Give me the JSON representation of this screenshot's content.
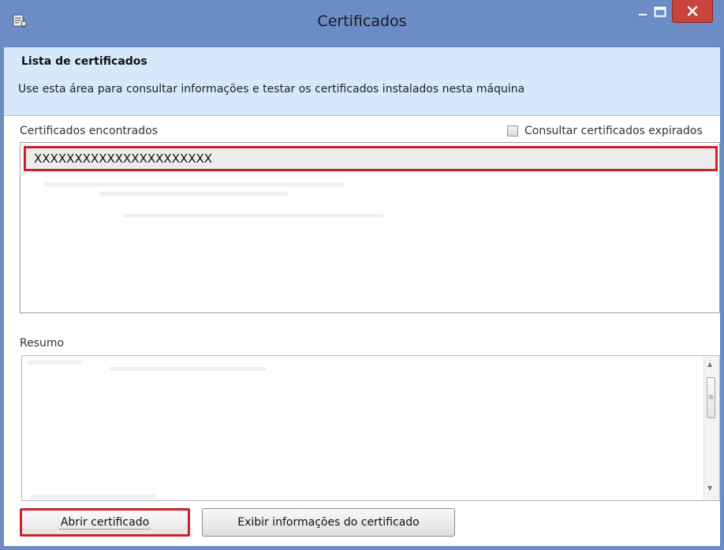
{
  "window": {
    "title": "Certificados"
  },
  "header": {
    "title": "Lista de certificados",
    "description": "Use esta área para consultar informações e testar os certificados instalados nesta máquina"
  },
  "certificates": {
    "label": "Certificados encontrados",
    "expired_checkbox_label": "Consultar certificados expirados",
    "expired_checked": false,
    "items": [
      "XXXXXXXXXXXXXXXXXXXXXX"
    ]
  },
  "summary": {
    "label": "Resumo"
  },
  "buttons": {
    "open": "Abrir certificado",
    "info": "Exibir informações do certificado"
  },
  "colors": {
    "titlebar": "#6b8cc4",
    "header_bg": "#d6e9fb",
    "highlight": "#d1202a",
    "close_button": "#c9443b"
  }
}
